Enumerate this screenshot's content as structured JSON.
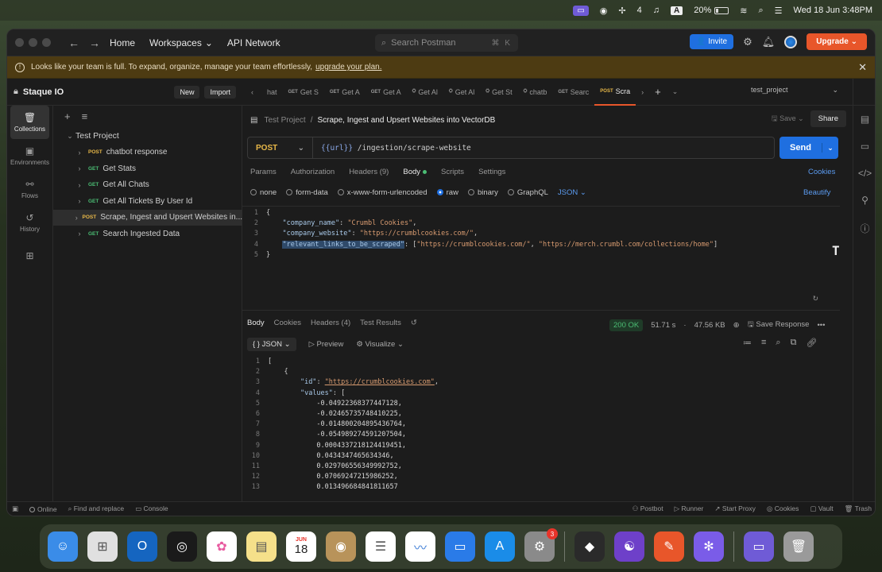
{
  "menubar": {
    "battery": "20%",
    "count": "4",
    "keyboard": "A",
    "clock": "Wed 18 Jun  3:48PM"
  },
  "topbar": {
    "home": "Home",
    "workspaces": "Workspaces",
    "api_network": "API Network",
    "search_placeholder": "Search Postman",
    "search_shortcut": "⌘ K",
    "invite": "Invite",
    "upgrade": "Upgrade"
  },
  "banner": {
    "text": "Looks like your team is full. To expand, organize, manage your team effortlessly,",
    "link": "upgrade your plan."
  },
  "rail": [
    {
      "label": "Collections",
      "icon": "collections-icon"
    },
    {
      "label": "Environments",
      "icon": "environments-icon"
    },
    {
      "label": "Flows",
      "icon": "flows-icon"
    },
    {
      "label": "History",
      "icon": "history-icon"
    },
    {
      "label": "",
      "icon": "apps-icon"
    }
  ],
  "sidebar": {
    "workspace": "Staque IO",
    "new": "New",
    "import": "Import",
    "collection": "Test Project",
    "items": [
      {
        "method": "POST",
        "name": "chatbot response"
      },
      {
        "method": "GET",
        "name": "Get Stats"
      },
      {
        "method": "GET",
        "name": "Get All Chats"
      },
      {
        "method": "GET",
        "name": "Get All Tickets By User Id"
      },
      {
        "method": "POST",
        "name": "Scrape, Ingest and Upsert Websites in..."
      },
      {
        "method": "GET",
        "name": "Search Ingested Data"
      }
    ]
  },
  "tabs": [
    {
      "method": "",
      "name": "hat"
    },
    {
      "method": "GET",
      "name": "Get S"
    },
    {
      "method": "GET",
      "name": "Get A"
    },
    {
      "method": "GET",
      "name": "Get A"
    },
    {
      "method": "⛭",
      "name": "Get Al"
    },
    {
      "method": "⛭",
      "name": "Get Al"
    },
    {
      "method": "⛭",
      "name": "Get St"
    },
    {
      "method": "⛭",
      "name": "chatb"
    },
    {
      "method": "GET",
      "name": "Searc"
    },
    {
      "method": "POST",
      "name": "Scra"
    }
  ],
  "environment": "test_project",
  "request": {
    "breadcrumb_parent": "Test Project",
    "breadcrumb_current": "Scrape, Ingest and Upsert Websites into VectorDB",
    "save": "Save",
    "share": "Share",
    "method": "POST",
    "url_var": "{{url}}",
    "url_path": " /ingestion/scrape-website",
    "send": "Send",
    "tabs": [
      "Params",
      "Authorization",
      "Headers (9)",
      "Body",
      "Scripts",
      "Settings"
    ],
    "cookies": "Cookies",
    "body_types": [
      "none",
      "form-data",
      "x-www-form-urlencoded",
      "raw",
      "binary",
      "GraphQL"
    ],
    "body_format": "JSON",
    "beautify": "Beautify",
    "code": {
      "l1": "{",
      "key1": "\"company_name\"",
      "val1": "\"Crumbl Cookies\"",
      "key2": "\"company_website\"",
      "val2": "\"https://crumblcookies.com/\"",
      "key3": "\"relevant_links_to_be_scraped\"",
      "val3a": "\"https://crumblcookies.com/\"",
      "val3b": "\"https://merch.crumbl.com/collections/home\"",
      "l5": "}"
    }
  },
  "response": {
    "tabs": [
      "Body",
      "Cookies",
      "Headers (4)",
      "Test Results"
    ],
    "status": "200 OK",
    "time": "51.71 s",
    "size": "47.56 KB",
    "save_response": "Save Response",
    "format": "JSON",
    "preview": "Preview",
    "visualize": "Visualize",
    "id_key": "\"id\"",
    "id_val": "\"https://crumblcookies.com\"",
    "values_key": "\"values\"",
    "values": [
      "-0.04922368377447128,",
      "-0.02465735748410225,",
      "-0.01480020489543676​4,",
      "-0.054989274591207504,",
      "0.0004337218124419451,",
      "0.0434347465634346,",
      "0.029706556349992752,",
      "0.07069247215986252,",
      "0.013496684841811657"
    ]
  },
  "statusbar": {
    "online": "Online",
    "find": "Find and replace",
    "console": "Console",
    "postbot": "Postbot",
    "runner": "Runner",
    "proxy": "Start Proxy",
    "cookies": "Cookies",
    "vault": "Vault",
    "trash": "Trash"
  },
  "dock": {
    "calendar_month": "JUN",
    "calendar_day": "18",
    "settings_badge": "3"
  }
}
